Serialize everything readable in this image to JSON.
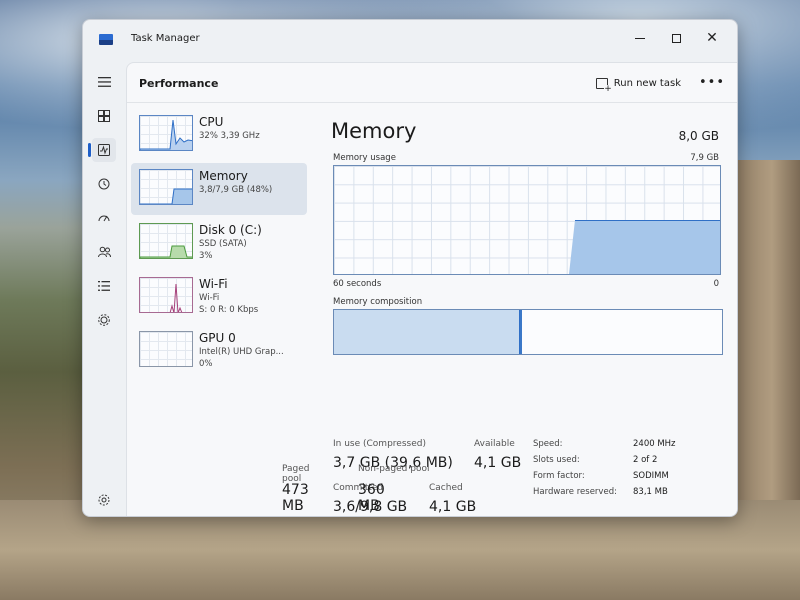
{
  "window": {
    "title": "Task Manager"
  },
  "nav": {
    "items": [
      {
        "icon": "hamburger-icon"
      },
      {
        "icon": "processes-icon"
      },
      {
        "icon": "performance-icon"
      },
      {
        "icon": "app-history-icon"
      },
      {
        "icon": "startup-apps-icon"
      },
      {
        "icon": "users-icon"
      },
      {
        "icon": "details-icon"
      },
      {
        "icon": "services-icon"
      }
    ],
    "settings_icon": "settings-icon"
  },
  "header": {
    "page_title": "Performance",
    "run_new_task_label": "Run new task",
    "more_label": "•••"
  },
  "perf_list": [
    {
      "name": "CPU",
      "sub1": "32% 3,39 GHz",
      "sub2": ""
    },
    {
      "name": "Memory",
      "sub1": "3,8/7,9 GB (48%)",
      "sub2": ""
    },
    {
      "name": "Disk 0 (C:)",
      "sub1": "SSD (SATA)",
      "sub2": "3%"
    },
    {
      "name": "Wi-Fi",
      "sub1": "Wi-Fi",
      "sub2": "S: 0 R: 0 Kbps"
    },
    {
      "name": "GPU 0",
      "sub1": "Intel(R) UHD Grap...",
      "sub2": "0%"
    }
  ],
  "detail": {
    "title": "Memory",
    "total": "8,0 GB",
    "usage_label": "Memory usage",
    "usage_max": "7,9 GB",
    "axis_left": "60 seconds",
    "axis_right": "0",
    "composition_label": "Memory composition",
    "stats": {
      "in_use_label": "In use (Compressed)",
      "in_use_value": "3,7 GB (39,6 MB)",
      "available_label": "Available",
      "available_value": "4,1 GB",
      "committed_label": "Committed",
      "committed_value": "3,6/9,8 GB",
      "cached_label": "Cached",
      "cached_value": "4,1 GB",
      "paged_pool_label": "Paged pool",
      "paged_pool_value": "473 MB",
      "non_paged_pool_label": "Non-paged pool",
      "non_paged_pool_value": "360 MB"
    },
    "properties": [
      {
        "label": "Speed:",
        "value": "2400 MHz"
      },
      {
        "label": "Slots used:",
        "value": "2 of 2"
      },
      {
        "label": "Form factor:",
        "value": "SODIMM"
      },
      {
        "label": "Hardware reserved:",
        "value": "83,1 MB"
      }
    ]
  },
  "colors": {
    "accent": "#1e5fc8",
    "memory_fill": "#a6c6ea",
    "memory_line": "#2f6fc6",
    "cpu_graph": "#2f6fc6",
    "disk_graph": "#4a9a3c",
    "wifi_graph": "#a6407a"
  }
}
